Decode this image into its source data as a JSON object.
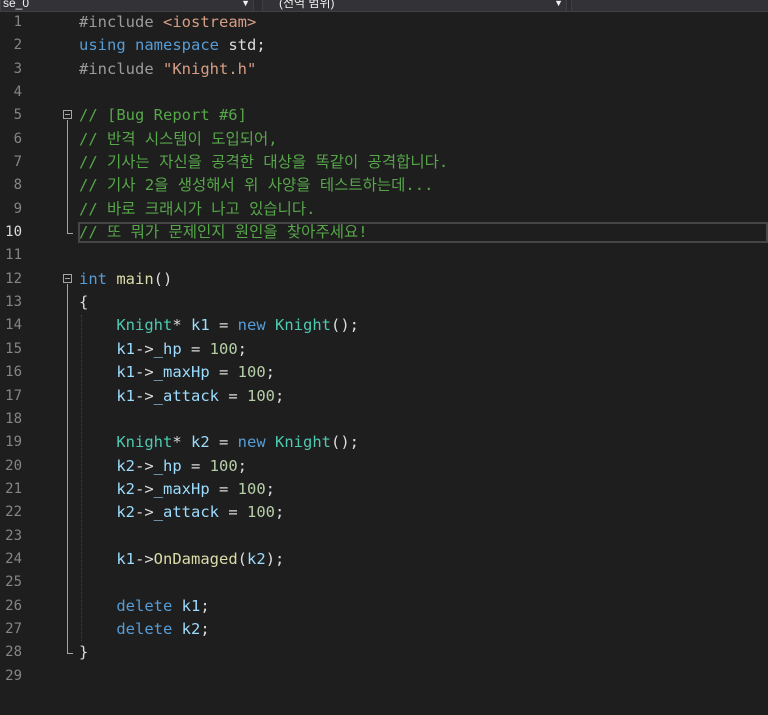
{
  "toolbar": {
    "project_dropdown": "se_0",
    "scope_dropdown": "(전역 범위)",
    "member_dropdown": ""
  },
  "editor": {
    "active_line": 10,
    "lines": [
      {
        "n": "1",
        "tokens": [
          [
            "pp",
            "#include "
          ],
          [
            "str",
            "<iostream>"
          ]
        ]
      },
      {
        "n": "2",
        "tokens": [
          [
            "kw",
            "using"
          ],
          [
            "op",
            " "
          ],
          [
            "kw",
            "namespace"
          ],
          [
            "op",
            " std;"
          ]
        ]
      },
      {
        "n": "3",
        "tokens": [
          [
            "pp",
            "#include "
          ],
          [
            "str",
            "\"Knight.h\""
          ]
        ]
      },
      {
        "n": "4",
        "tokens": []
      },
      {
        "n": "5",
        "tokens": [
          [
            "cm",
            "// [Bug Report #6]"
          ]
        ]
      },
      {
        "n": "6",
        "tokens": [
          [
            "cm",
            "// 반격 시스템이 도입되어,"
          ]
        ]
      },
      {
        "n": "7",
        "tokens": [
          [
            "cm",
            "// 기사는 자신을 공격한 대상을 똑같이 공격합니다."
          ]
        ]
      },
      {
        "n": "8",
        "tokens": [
          [
            "cm",
            "// 기사 2을 생성해서 위 사양을 테스트하는데..."
          ]
        ]
      },
      {
        "n": "9",
        "tokens": [
          [
            "cm",
            "// 바로 크래시가 나고 있습니다."
          ]
        ]
      },
      {
        "n": "10",
        "tokens": [
          [
            "cm",
            "// 또 뭐가 문제인지 원인을 찾아주세요!"
          ]
        ]
      },
      {
        "n": "11",
        "tokens": []
      },
      {
        "n": "12",
        "tokens": [
          [
            "kw",
            "int"
          ],
          [
            "op",
            " "
          ],
          [
            "fn",
            "main"
          ],
          [
            "op",
            "()"
          ]
        ]
      },
      {
        "n": "13",
        "tokens": [
          [
            "op",
            "{"
          ]
        ]
      },
      {
        "n": "14",
        "tokens": [
          [
            "op",
            "    "
          ],
          [
            "ty",
            "Knight"
          ],
          [
            "op",
            "* "
          ],
          [
            "var",
            "k1"
          ],
          [
            "op",
            " = "
          ],
          [
            "kw",
            "new"
          ],
          [
            "op",
            " "
          ],
          [
            "ty",
            "Knight"
          ],
          [
            "op",
            "();"
          ]
        ]
      },
      {
        "n": "15",
        "tokens": [
          [
            "op",
            "    "
          ],
          [
            "var",
            "k1"
          ],
          [
            "op",
            "->"
          ],
          [
            "var",
            "_hp"
          ],
          [
            "op",
            " = "
          ],
          [
            "num",
            "100"
          ],
          [
            "op",
            ";"
          ]
        ]
      },
      {
        "n": "16",
        "tokens": [
          [
            "op",
            "    "
          ],
          [
            "var",
            "k1"
          ],
          [
            "op",
            "->"
          ],
          [
            "var",
            "_maxHp"
          ],
          [
            "op",
            " = "
          ],
          [
            "num",
            "100"
          ],
          [
            "op",
            ";"
          ]
        ]
      },
      {
        "n": "17",
        "tokens": [
          [
            "op",
            "    "
          ],
          [
            "var",
            "k1"
          ],
          [
            "op",
            "->"
          ],
          [
            "var",
            "_attack"
          ],
          [
            "op",
            " = "
          ],
          [
            "num",
            "100"
          ],
          [
            "op",
            ";"
          ]
        ]
      },
      {
        "n": "18",
        "tokens": []
      },
      {
        "n": "19",
        "tokens": [
          [
            "op",
            "    "
          ],
          [
            "ty",
            "Knight"
          ],
          [
            "op",
            "* "
          ],
          [
            "var",
            "k2"
          ],
          [
            "op",
            " = "
          ],
          [
            "kw",
            "new"
          ],
          [
            "op",
            " "
          ],
          [
            "ty",
            "Knight"
          ],
          [
            "op",
            "();"
          ]
        ]
      },
      {
        "n": "20",
        "tokens": [
          [
            "op",
            "    "
          ],
          [
            "var",
            "k2"
          ],
          [
            "op",
            "->"
          ],
          [
            "var",
            "_hp"
          ],
          [
            "op",
            " = "
          ],
          [
            "num",
            "100"
          ],
          [
            "op",
            ";"
          ]
        ]
      },
      {
        "n": "21",
        "tokens": [
          [
            "op",
            "    "
          ],
          [
            "var",
            "k2"
          ],
          [
            "op",
            "->"
          ],
          [
            "var",
            "_maxHp"
          ],
          [
            "op",
            " = "
          ],
          [
            "num",
            "100"
          ],
          [
            "op",
            ";"
          ]
        ]
      },
      {
        "n": "22",
        "tokens": [
          [
            "op",
            "    "
          ],
          [
            "var",
            "k2"
          ],
          [
            "op",
            "->"
          ],
          [
            "var",
            "_attack"
          ],
          [
            "op",
            " = "
          ],
          [
            "num",
            "100"
          ],
          [
            "op",
            ";"
          ]
        ]
      },
      {
        "n": "23",
        "tokens": []
      },
      {
        "n": "24",
        "tokens": [
          [
            "op",
            "    "
          ],
          [
            "var",
            "k1"
          ],
          [
            "op",
            "->"
          ],
          [
            "fn",
            "OnDamaged"
          ],
          [
            "op",
            "("
          ],
          [
            "var",
            "k2"
          ],
          [
            "op",
            ");"
          ]
        ]
      },
      {
        "n": "25",
        "tokens": []
      },
      {
        "n": "26",
        "tokens": [
          [
            "op",
            "    "
          ],
          [
            "kw",
            "delete"
          ],
          [
            "op",
            " "
          ],
          [
            "var",
            "k1"
          ],
          [
            "op",
            ";"
          ]
        ]
      },
      {
        "n": "27",
        "tokens": [
          [
            "op",
            "    "
          ],
          [
            "kw",
            "delete"
          ],
          [
            "op",
            " "
          ],
          [
            "var",
            "k2"
          ],
          [
            "op",
            ";"
          ]
        ]
      },
      {
        "n": "28",
        "tokens": [
          [
            "op",
            "}"
          ]
        ]
      },
      {
        "n": "29",
        "tokens": []
      }
    ]
  }
}
